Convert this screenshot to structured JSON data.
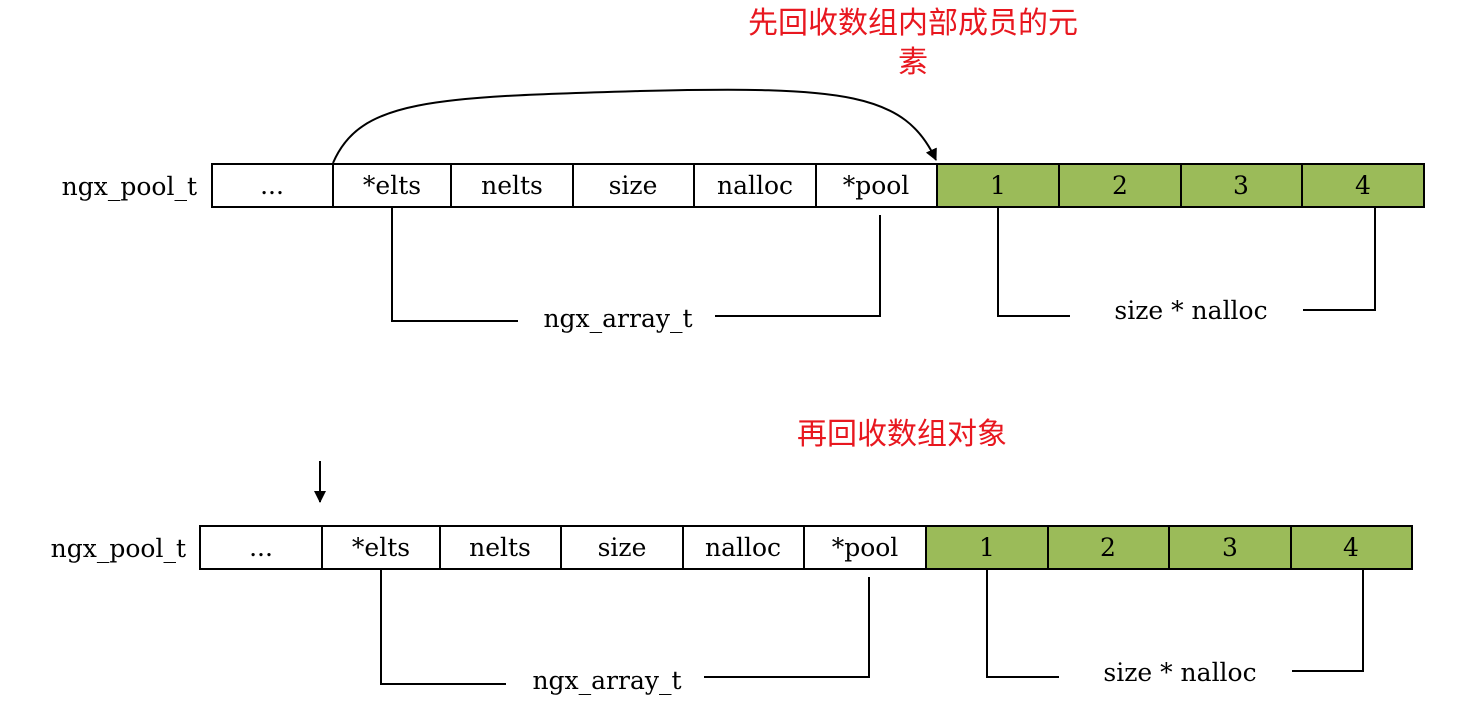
{
  "colors": {
    "accent_red": "#e8171f",
    "array_fill": "#9bbb59",
    "stroke": "#000000",
    "box_fill": "#ffffff"
  },
  "top": {
    "caption_line1": "先回收数组内部成员的元",
    "caption_line2": "素",
    "pool_label": "ngx_pool_t",
    "cells": [
      "...",
      "*elts",
      "nelts",
      "size",
      "nalloc",
      "*pool"
    ],
    "elements": [
      "1",
      "2",
      "3",
      "4"
    ],
    "array_label": "ngx_array_t",
    "size_label": "size * nalloc"
  },
  "bottom": {
    "caption": "再回收数组对象",
    "pool_label": "ngx_pool_t",
    "cells": [
      "...",
      "*elts",
      "nelts",
      "size",
      "nalloc",
      "*pool"
    ],
    "elements": [
      "1",
      "2",
      "3",
      "4"
    ],
    "array_label": "ngx_array_t",
    "size_label": "size * nalloc"
  }
}
